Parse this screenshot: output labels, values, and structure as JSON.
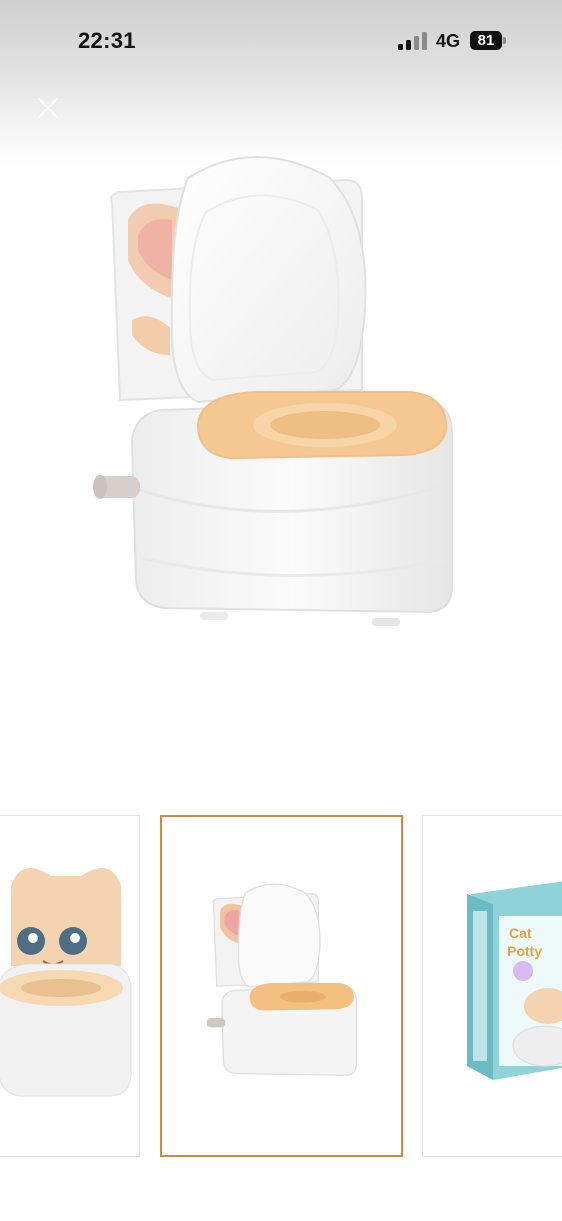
{
  "status_bar": {
    "time": "22:31",
    "network": "4G",
    "battery": "81"
  },
  "icons": {
    "close": "close-icon",
    "signal": "signal-icon",
    "battery": "battery-icon"
  },
  "gallery": {
    "selected_index": 1,
    "accent_color": "#d08a3e"
  },
  "box_text": {
    "line1": "Cat",
    "line2": "Potty"
  }
}
